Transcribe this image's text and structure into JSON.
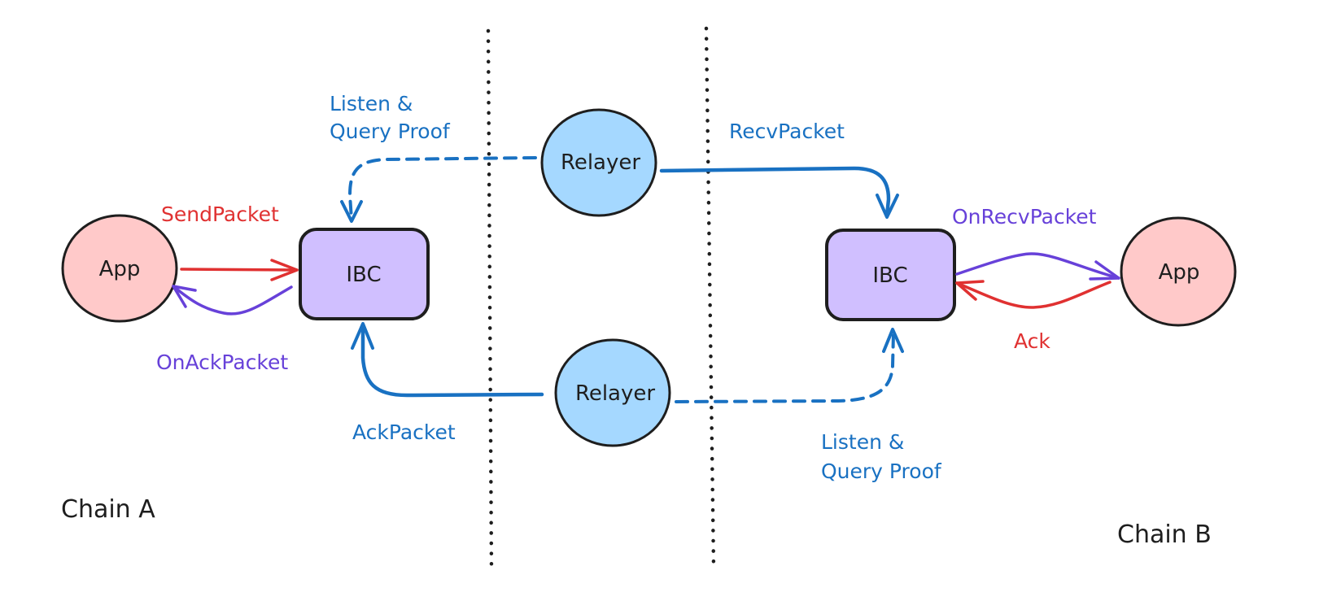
{
  "colors": {
    "app_fill": "#ffc9c9",
    "ibc_fill": "#d0bfff",
    "relayer_fill": "#a5d8ff",
    "stroke": "#1e1e1e",
    "blue": "#1971c2",
    "red": "#e03131",
    "purple": "#6741d9"
  },
  "nodes": {
    "app_a": "App",
    "ibc_a": "IBC",
    "relayer_top": "Relayer",
    "relayer_bottom": "Relayer",
    "ibc_b": "IBC",
    "app_b": "App"
  },
  "chains": {
    "a": "Chain A",
    "b": "Chain B"
  },
  "edges": {
    "send_packet": "SendPacket",
    "on_ack_packet": "OnAckPacket",
    "listen_top_line1": "Listen &",
    "listen_top_line2": "Query Proof",
    "recv_packet": "RecvPacket",
    "on_recv_packet": "OnRecvPacket",
    "ack": "Ack",
    "ack_packet": "AckPacket",
    "listen_bottom_line1": "Listen &",
    "listen_bottom_line2": "Query Proof"
  }
}
